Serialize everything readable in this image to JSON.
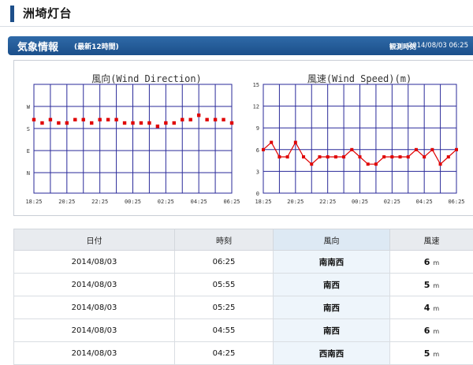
{
  "page": {
    "title": "洲埼灯台"
  },
  "section": {
    "title": "気象情報",
    "subtitle": "(最新12時間)",
    "obs_label": "観測時刻",
    "obs_time": "2014/08/03 06:25"
  },
  "charts": {
    "direction": {
      "title": "風向(Wind Direction)",
      "y_ticks": [
        "W",
        "S",
        "E",
        "N"
      ],
      "x_ticks": [
        "18:25",
        "20:25",
        "22:25",
        "00:25",
        "02:25",
        "04:25",
        "06:25"
      ]
    },
    "speed": {
      "title": "風速(Wind Speed)(m)",
      "y_ticks": [
        "15",
        "12",
        "9",
        "6",
        "3",
        "0"
      ],
      "x_ticks": [
        "18:25",
        "20:25",
        "22:25",
        "00:25",
        "02:25",
        "04:25",
        "06:25"
      ]
    }
  },
  "chart_data": [
    {
      "type": "scatter",
      "title": "風向(Wind Direction)",
      "y_axis": "compass (N=0, E=1, S=2, W=3 quadrants)",
      "x": [
        "18:25",
        "18:55",
        "19:25",
        "19:55",
        "20:25",
        "20:55",
        "21:25",
        "21:55",
        "22:25",
        "22:55",
        "23:25",
        "23:55",
        "00:25",
        "00:55",
        "01:25",
        "01:55",
        "02:25",
        "02:55",
        "03:25",
        "03:55",
        "04:25",
        "04:55",
        "05:25",
        "05:55",
        "06:25"
      ],
      "values": [
        2.4,
        2.25,
        2.4,
        2.25,
        2.25,
        2.4,
        2.4,
        2.25,
        2.4,
        2.4,
        2.4,
        2.25,
        2.25,
        2.25,
        2.25,
        2.1,
        2.25,
        2.25,
        2.4,
        2.4,
        2.6,
        2.4,
        2.4,
        2.4,
        2.25
      ],
      "color": "#e00000"
    },
    {
      "type": "line",
      "title": "風速(Wind Speed)(m)",
      "x": [
        "18:25",
        "18:55",
        "19:25",
        "19:55",
        "20:25",
        "20:55",
        "21:25",
        "21:55",
        "22:25",
        "22:55",
        "23:25",
        "23:55",
        "00:25",
        "00:55",
        "01:25",
        "01:55",
        "02:25",
        "02:55",
        "03:25",
        "03:55",
        "04:25",
        "04:55",
        "05:25",
        "05:55",
        "06:25"
      ],
      "values": [
        6,
        7,
        5,
        5,
        7,
        5,
        4,
        5,
        5,
        5,
        5,
        6,
        5,
        4,
        4,
        5,
        5,
        5,
        5,
        6,
        5,
        6,
        4,
        5,
        6
      ],
      "ylim": [
        0,
        15
      ],
      "color": "#e00000"
    }
  ],
  "table": {
    "headers": [
      "日付",
      "時刻",
      "風向",
      "風速"
    ],
    "unit": "m",
    "rows": [
      {
        "date": "2014/08/03",
        "time": "06:25",
        "dir": "南南西",
        "speed": "6"
      },
      {
        "date": "2014/08/03",
        "time": "05:55",
        "dir": "南西",
        "speed": "5"
      },
      {
        "date": "2014/08/03",
        "time": "05:25",
        "dir": "南西",
        "speed": "4"
      },
      {
        "date": "2014/08/03",
        "time": "04:55",
        "dir": "南西",
        "speed": "6"
      },
      {
        "date": "2014/08/03",
        "time": "04:25",
        "dir": "西南西",
        "speed": "5"
      }
    ]
  },
  "colors": {
    "accent": "#1d4f8a",
    "grid": "#2a2a9a",
    "series": "#e00000"
  }
}
